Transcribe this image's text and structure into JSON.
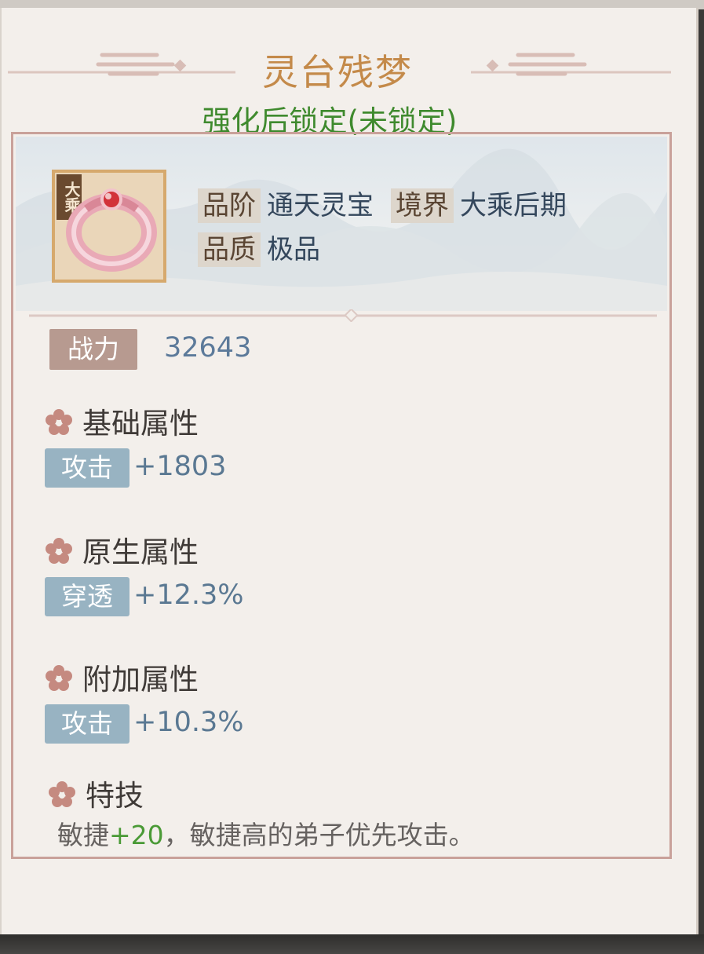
{
  "title": "灵台残梦",
  "subtitle": "强化后锁定(未锁定)",
  "item": {
    "tier_badge": "大乘",
    "icon": "ring-icon",
    "grade_label": "品阶",
    "grade_value": "通天灵宝",
    "realm_label": "境界",
    "realm_value": "大乘后期",
    "quality_label": "品质",
    "quality_value": "极品"
  },
  "power": {
    "label": "战力",
    "value": "32643"
  },
  "sections": [
    {
      "title": "基础属性",
      "stat_label": "攻击",
      "stat_value": "+1803"
    },
    {
      "title": "原生属性",
      "stat_label": "穿透",
      "stat_value": "+12.3%"
    },
    {
      "title": "附加属性",
      "stat_label": "攻击",
      "stat_value": "+10.3%"
    }
  ],
  "skill": {
    "title": "特技",
    "text_prefix": "敏捷",
    "text_bonus": "+20",
    "text_suffix": "，敏捷高的弟子优先攻击。"
  },
  "colors": {
    "title": "#c48a4a",
    "subtitle": "#3f8a2e",
    "power_tag": "#b79a90",
    "stat_tag": "#98b3c2",
    "frame": "#c9a19a"
  }
}
